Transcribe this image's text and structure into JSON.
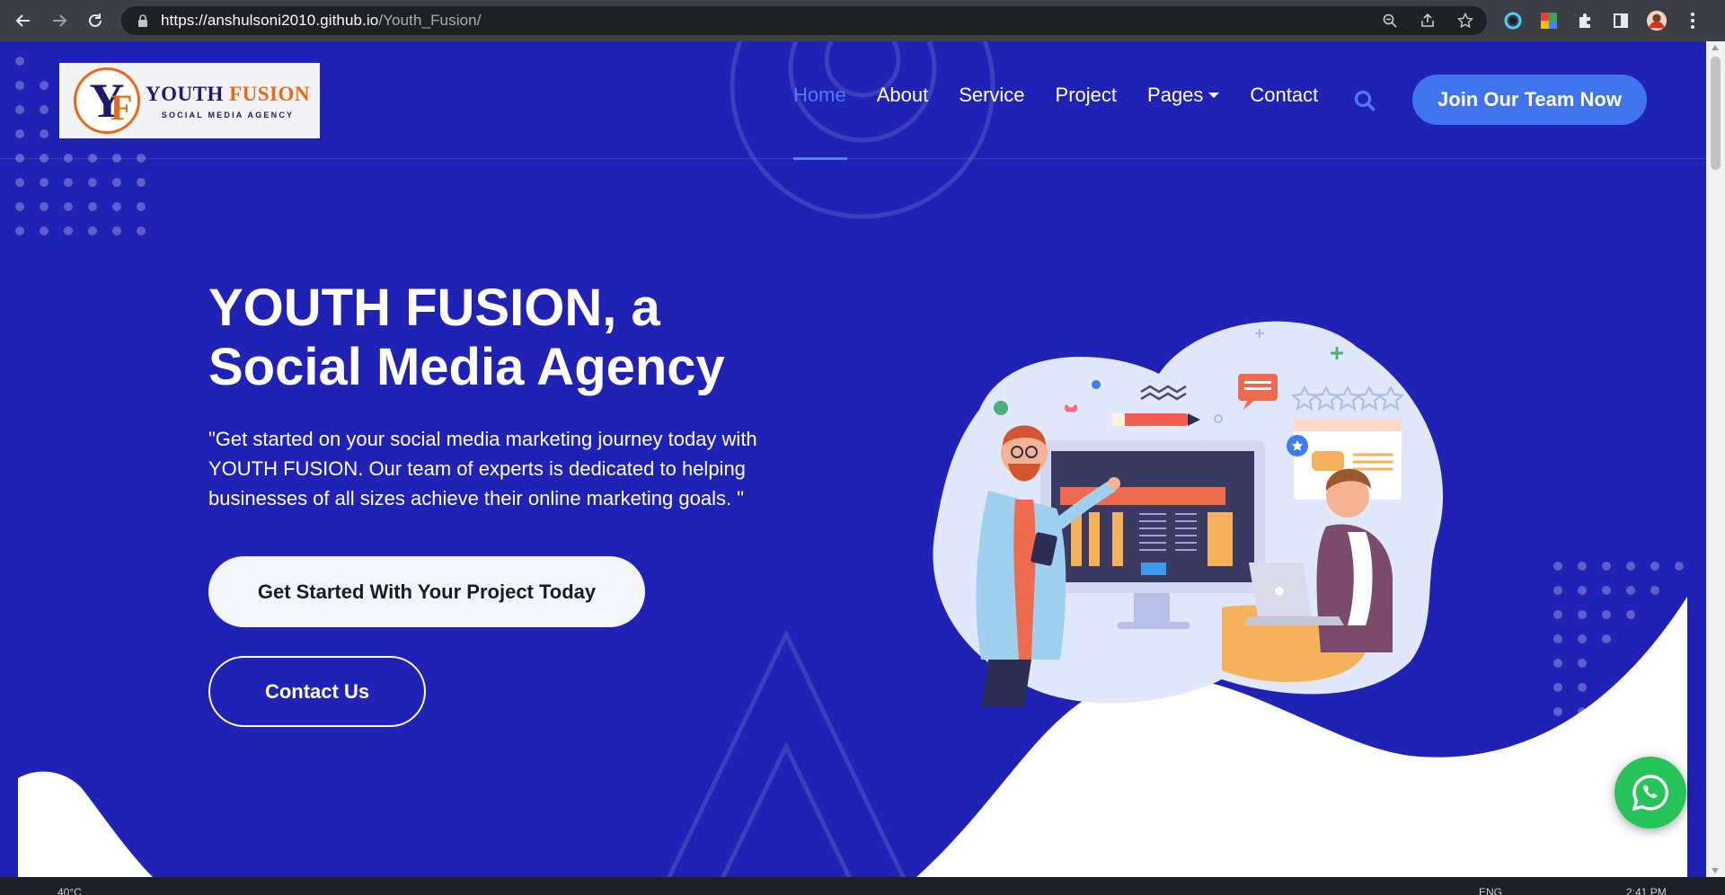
{
  "browser": {
    "url_host": "https://anshulsoni2010.github.io",
    "url_path": "/Youth_Fusion/"
  },
  "brand": {
    "logo_initial_y": "Y",
    "logo_initial_f": "F",
    "name_part1": "YOUTH",
    "name_part2": "FUSION",
    "tagline": "SOCIAL MEDIA AGENCY"
  },
  "nav": {
    "items": [
      {
        "label": "Home",
        "active": true
      },
      {
        "label": "About",
        "active": false
      },
      {
        "label": "Service",
        "active": false
      },
      {
        "label": "Project",
        "active": false
      },
      {
        "label": "Pages",
        "active": false,
        "dropdown": true
      },
      {
        "label": "Contact",
        "active": false
      }
    ],
    "cta_label": "Join Our Team Now"
  },
  "hero": {
    "title": "YOUTH FUSION, a Social Media Agency",
    "description": "\"Get started on your social media marketing journey today with YOUTH FUSION. Our team of experts is dedicated to helping businesses of all sizes achieve their online marketing goals. \"",
    "primary_button": "Get Started With Your Project Today",
    "secondary_button": "Contact Us"
  },
  "taskbar": {
    "weather": "40°C",
    "lang": "ENG",
    "time": "2:41 PM"
  },
  "colors": {
    "page_bg": "#2022b5",
    "accent_blue": "#3f74ec",
    "active_link": "#4e7cf5",
    "logo_orange": "#e66a1a",
    "whatsapp_green": "#25c35a"
  }
}
